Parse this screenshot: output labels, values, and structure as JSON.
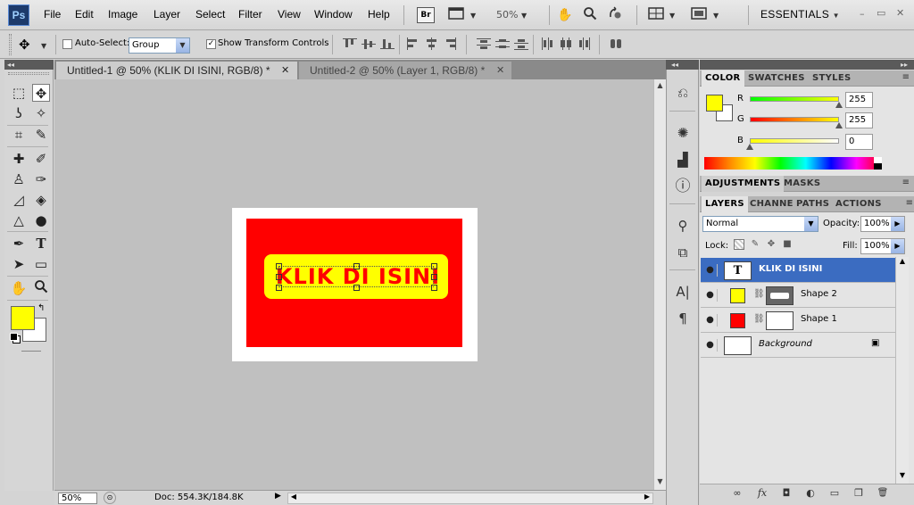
{
  "app": {
    "logo": "Ps",
    "menus": [
      "File",
      "Edit",
      "Image",
      "Layer",
      "Select",
      "Filter",
      "View",
      "Window",
      "Help"
    ],
    "bridge_label": "Br",
    "zoom_level": "50%",
    "workspace": "ESSENTIALS",
    "window_controls": [
      "–",
      "▭",
      "✕"
    ]
  },
  "options_bar": {
    "auto_select_label": "Auto-Select:",
    "auto_select_checked": false,
    "auto_select_mode": "Group",
    "show_transform_label": "Show Transform Controls",
    "show_transform_checked": true
  },
  "tabs": [
    {
      "title": "Untitled-1 @ 50% (KLIK DI ISINI, RGB/8) *",
      "active": true
    },
    {
      "title": "Untitled-2 @ 50% (Layer 1, RGB/8) *",
      "active": false
    }
  ],
  "canvas": {
    "text": "KLIK DI ISINI",
    "colors": {
      "red": "#ff0000",
      "yellow": "#ffff00",
      "white": "#ffffff",
      "pasteboard": "#c0c0c0"
    }
  },
  "status": {
    "zoom": "50%",
    "doc_size": "Doc: 554.3K/184.8K"
  },
  "color_panel": {
    "tabs": [
      "COLOR",
      "SWATCHES",
      "STYLES"
    ],
    "channels": [
      {
        "label": "R",
        "value": "255",
        "level": 1.0
      },
      {
        "label": "G",
        "value": "255",
        "level": 1.0
      },
      {
        "label": "B",
        "value": "0",
        "level": 0.0
      }
    ],
    "fg_color": "#ffff00",
    "bg_color": "#ffffff"
  },
  "adjustments_tabs": [
    "ADJUSTMENTS",
    "MASKS"
  ],
  "layers_panel": {
    "tabs": [
      "LAYERS",
      "CHANNELS",
      "PATHS",
      "ACTIONS"
    ],
    "blend_mode": "Normal",
    "opacity_label": "Opacity:",
    "opacity": "100%",
    "lock_label": "Lock:",
    "fill_label": "Fill:",
    "fill": "100%",
    "layers": [
      {
        "name": "KLIK DI ISINI",
        "type": "text",
        "thumb_glyph": "T",
        "active": true
      },
      {
        "name": "Shape 2",
        "type": "shape",
        "color": "#ffff00",
        "active": false
      },
      {
        "name": "Shape 1",
        "type": "shape",
        "color": "#ff0000",
        "active": false
      },
      {
        "name": "Background",
        "type": "background",
        "active": false
      }
    ],
    "footer_icons": [
      "link-icon",
      "fx-icon",
      "mask-icon",
      "adjustment-icon",
      "folder-icon",
      "new-layer-icon",
      "trash-icon"
    ],
    "footer_glyphs": [
      "∞",
      "fx",
      "◘",
      "◐",
      "▭",
      "❐",
      "🗑"
    ]
  },
  "icons": {
    "move": "✥",
    "marquee": "⬚",
    "lasso": "ʖ",
    "wand": "✧",
    "crop": "⌗",
    "eyedropper": "✎",
    "heal": "✚",
    "brush": "✐",
    "stamp": "♙",
    "history": "✑",
    "eraser": "◿",
    "bucket": "◈",
    "blur": "△",
    "dodge": "●",
    "pen": "✒",
    "type": "T",
    "path_select": "➤",
    "shape": "▭",
    "hand": "✋",
    "zoom": "🔍",
    "mid_history": "⎌",
    "mid_navigator": "✺",
    "mid_histogram": "▟",
    "mid_info": "ⓘ",
    "mid_brushes": "⚲",
    "mid_clone": "⧉",
    "mid_character": "A|",
    "mid_paragraph": "¶",
    "eye": "👁",
    "lock": "🔒"
  }
}
